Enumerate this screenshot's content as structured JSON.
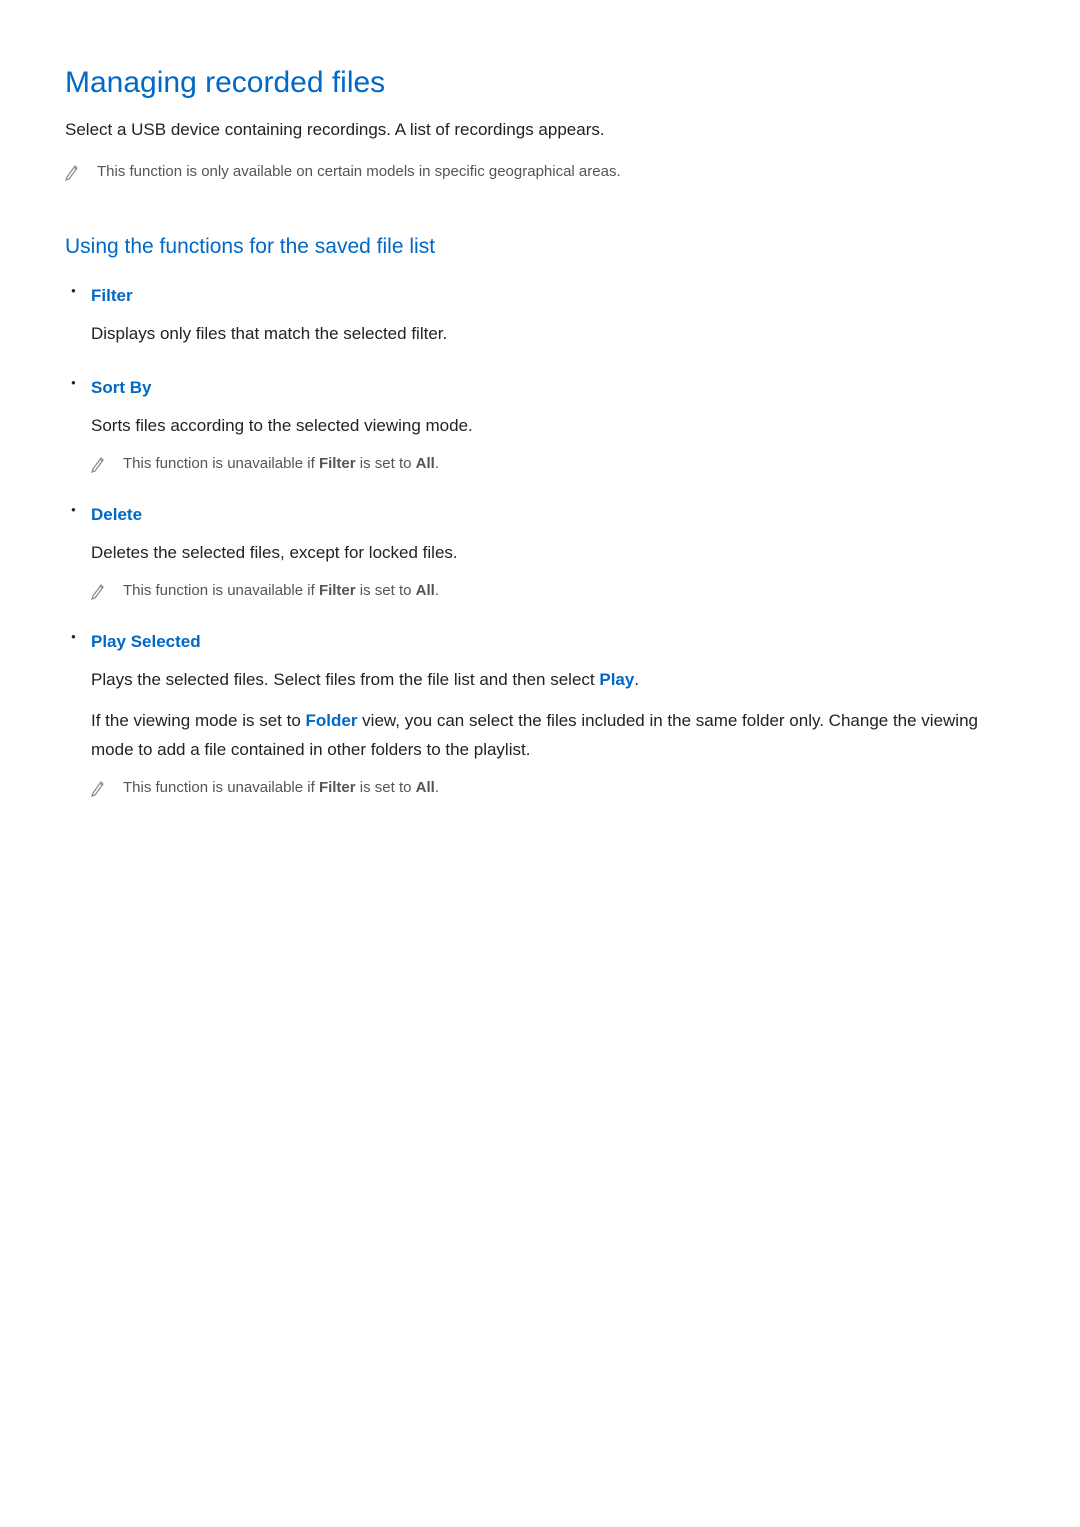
{
  "title": "Managing recorded files",
  "intro": "Select a USB device containing recordings. A list of recordings appears.",
  "topNote": "This function is only available on certain models in specific geographical areas.",
  "sectionTitle": "Using the functions for the saved file list",
  "features": {
    "filter": {
      "title": "Filter",
      "desc": "Displays only files that match the selected filter."
    },
    "sortBy": {
      "title": "Sort By",
      "desc": "Sorts files according to the selected viewing mode.",
      "notePrefix": "This function is unavailable if ",
      "noteTerm1": "Filter",
      "noteMid": " is set to ",
      "noteTerm2": "All",
      "noteSuffix": "."
    },
    "delete": {
      "title": "Delete",
      "desc": "Deletes the selected files, except for locked files.",
      "notePrefix": "This function is unavailable if ",
      "noteTerm1": "Filter",
      "noteMid": " is set to ",
      "noteTerm2": "All",
      "noteSuffix": "."
    },
    "playSelected": {
      "title": "Play Selected",
      "desc1Prefix": "Plays the selected files. Select files from the file list and then select ",
      "desc1Term": "Play",
      "desc1Suffix": ".",
      "desc2Prefix": "If the viewing mode is set to ",
      "desc2Term": "Folder",
      "desc2Suffix": " view, you can select the files included in the same folder only. Change the viewing mode to add a file contained in other folders to the playlist.",
      "notePrefix": "This function is unavailable if ",
      "noteTerm1": "Filter",
      "noteMid": " is set to ",
      "noteTerm2": "All",
      "noteSuffix": "."
    }
  }
}
